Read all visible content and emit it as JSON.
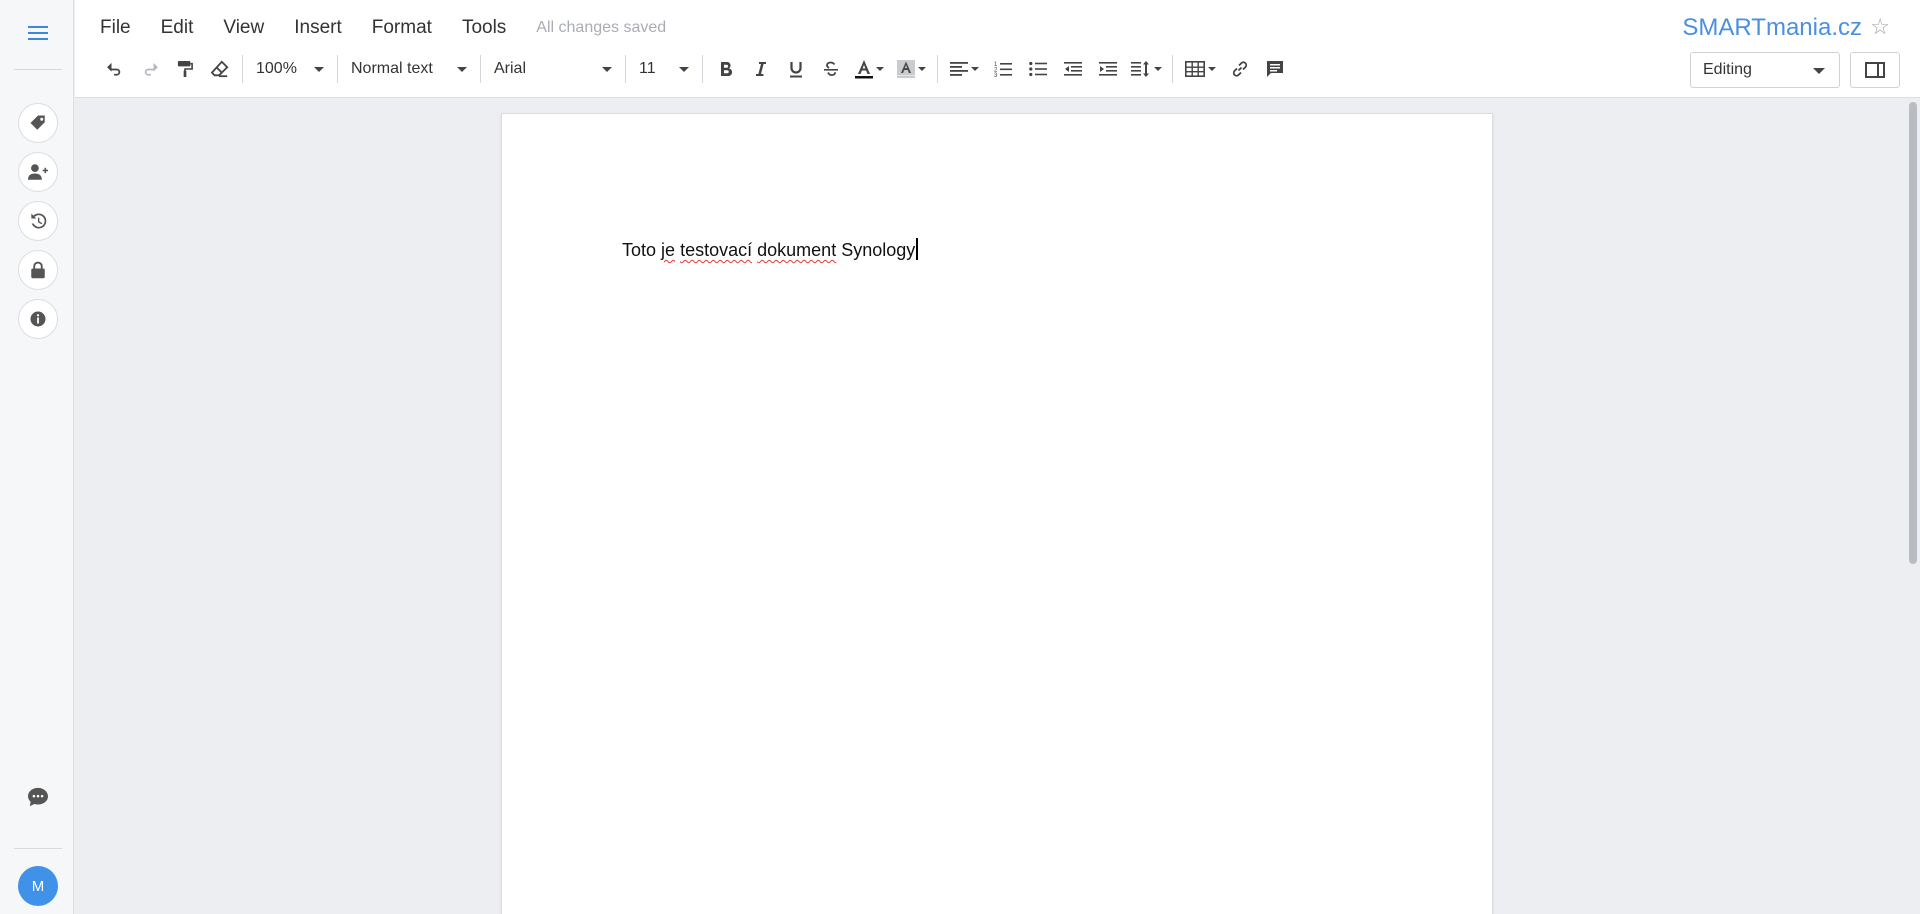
{
  "menu": {
    "items": [
      "File",
      "Edit",
      "View",
      "Insert",
      "Format",
      "Tools"
    ],
    "status": "All changes saved"
  },
  "brand": {
    "name": "SMARTmania.cz",
    "star_icon": "star-outline-icon"
  },
  "toolbar": {
    "zoom": "100%",
    "style": "Normal text",
    "font": "Arial",
    "size": "11"
  },
  "mode": {
    "selected": "Editing"
  },
  "sidebar": {
    "icons": [
      "menu-icon",
      "tag-icon",
      "add-person-icon",
      "history-icon",
      "lock-icon",
      "info-icon",
      "chat-icon"
    ],
    "avatar_initial": "M"
  },
  "document": {
    "words": [
      "Toto",
      "je",
      "testovací",
      "dokument",
      "Synology"
    ],
    "misspelled": [
      "je",
      "testovací",
      "dokument"
    ]
  },
  "colors": {
    "accent": "#4a8fe0",
    "avatar": "#3f92e8",
    "spellcheck": "#e53935"
  }
}
